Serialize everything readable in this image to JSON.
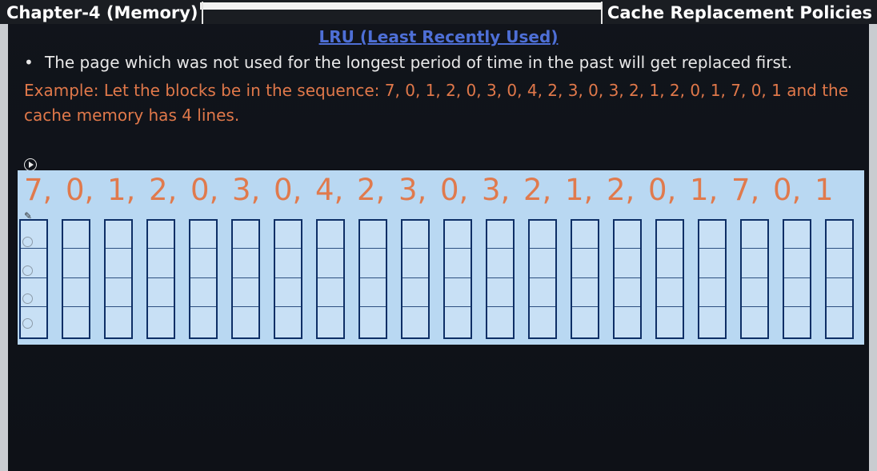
{
  "header": {
    "chapter_title": "Chapter-4 (Memory)",
    "section_title": "Cache Replacement Policies"
  },
  "slide": {
    "heading": "LRU (Least Recently Used)",
    "bullet": "The page which was not used for the longest period of time in the past will get replaced first.",
    "example": "Example:  Let the blocks be in the sequence: 7, 0, 1, 2, 0, 3, 0, 4, 2, 3, 0, 3, 2, 1, 2, 0, 1, 7, 0, 1 and the cache memory has 4 lines."
  },
  "sequence": [
    "7,",
    "0,",
    "1,",
    "2,",
    "0,",
    "3,",
    "0,",
    "4,",
    "2,",
    "3,",
    "0,",
    "3,",
    "2,",
    "1,",
    "2,",
    "0,",
    "1,",
    "7,",
    "0,",
    "1"
  ],
  "cache": {
    "columns": 20,
    "lines": 4
  },
  "colors": {
    "heading": "#4e6fd6",
    "example_text": "#e0784a",
    "panel": "#b9d8f2",
    "grid_border": "#0e2f66"
  }
}
